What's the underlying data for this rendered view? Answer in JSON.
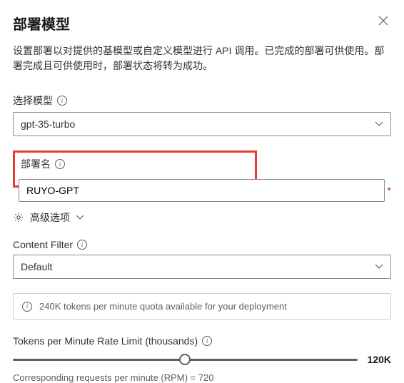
{
  "header": {
    "title": "部署模型"
  },
  "description": "设置部署以对提供的基模型或自定义模型进行 API 调用。已完成的部署可供使用。部署完成且可供使用时，部署状态将转为成功。",
  "model": {
    "label": "选择模型",
    "value": "gpt-35-turbo"
  },
  "deploymentName": {
    "label": "部署名",
    "value": "RUYO-GPT"
  },
  "advanced": {
    "label": "高级选项"
  },
  "contentFilter": {
    "label": "Content Filter",
    "value": "Default"
  },
  "notice": {
    "text": "240K tokens per minute quota available for your deployment"
  },
  "tpm": {
    "label": "Tokens per Minute Rate Limit (thousands)",
    "max": "120K"
  },
  "rpm": {
    "text": "Corresponding requests per minute (RPM) = 720"
  },
  "icons": {
    "close": "close-icon",
    "info": "info-icon",
    "chevron": "chevron-down-icon",
    "gear": "gear-icon"
  }
}
